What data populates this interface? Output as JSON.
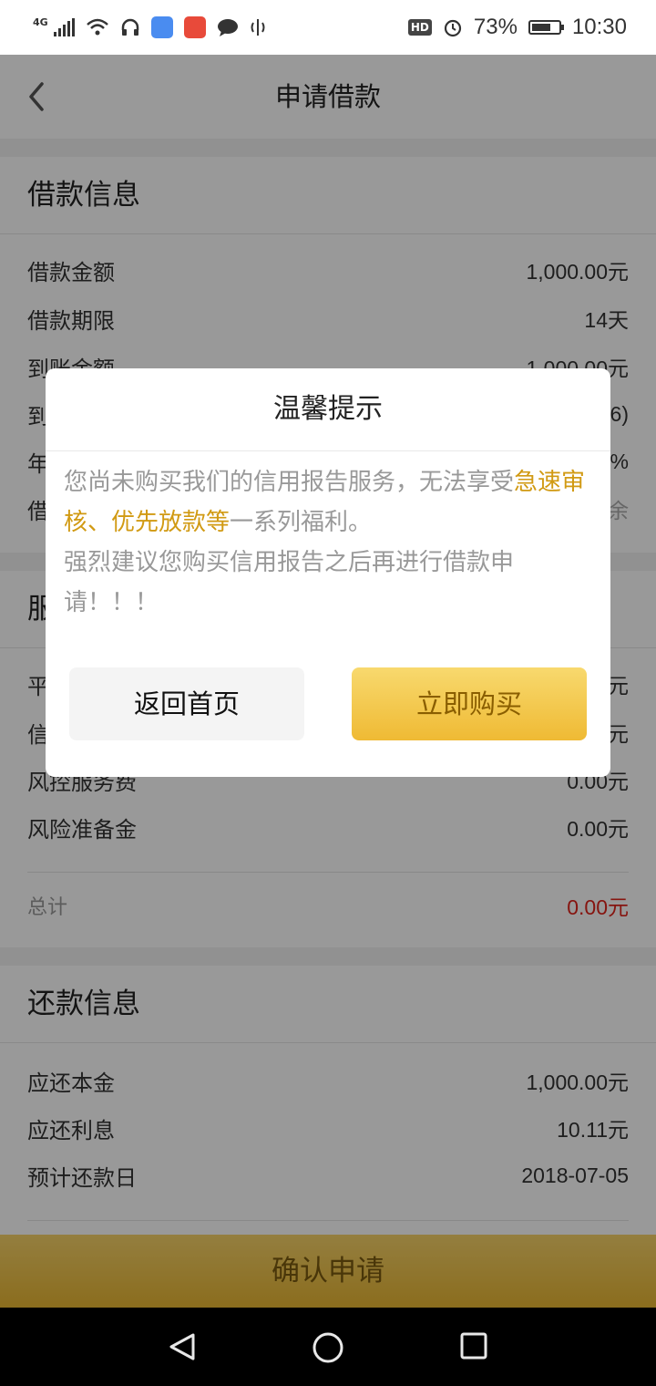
{
  "status": {
    "network": "4G",
    "battery": "73%",
    "time": "10:30",
    "battery_level": 0.73
  },
  "header": {
    "title": "申请借款"
  },
  "loan_info": {
    "title": "借款信息",
    "rows": [
      {
        "label": "借款金额",
        "value": "1,000.00元"
      },
      {
        "label": "借款期限",
        "value": "14天"
      },
      {
        "label": "到账金额",
        "value": "1,000.00元"
      },
      {
        "label": "到",
        "value": "6)"
      },
      {
        "label": "年",
        "value": "0%"
      },
      {
        "label": "借",
        "value": "余"
      }
    ]
  },
  "service": {
    "title": "服",
    "rows": [
      {
        "label": "平",
        "value": "元"
      },
      {
        "label": "信",
        "value": "元"
      },
      {
        "label": "风控服务费",
        "value": "0.00元"
      },
      {
        "label": "风险准备金",
        "value": "0.00元"
      }
    ],
    "total_label": "总计",
    "total_value": "0.00元"
  },
  "repay_info": {
    "title": "还款信息",
    "rows": [
      {
        "label": "应还本金",
        "value": "1,000.00元"
      },
      {
        "label": "应还利息",
        "value": "10.11元"
      },
      {
        "label": "预计还款日",
        "value": "2018-07-05"
      }
    ]
  },
  "confirm_label": "确认申请",
  "dialog": {
    "title": "温馨提示",
    "text1": "您尚未购买我们的信用报告服务，无法享受",
    "text_highlight": "急速审核、优先放款等",
    "text2": "一系列福利。",
    "text3": "强烈建议您购买信用报告之后再进行借款申请！！！",
    "btn_home": "返回首页",
    "btn_buy": "立即购买"
  },
  "colors": {
    "accent": "#efba34",
    "highlight": "#d19a13",
    "total_red": "#e0241c"
  }
}
